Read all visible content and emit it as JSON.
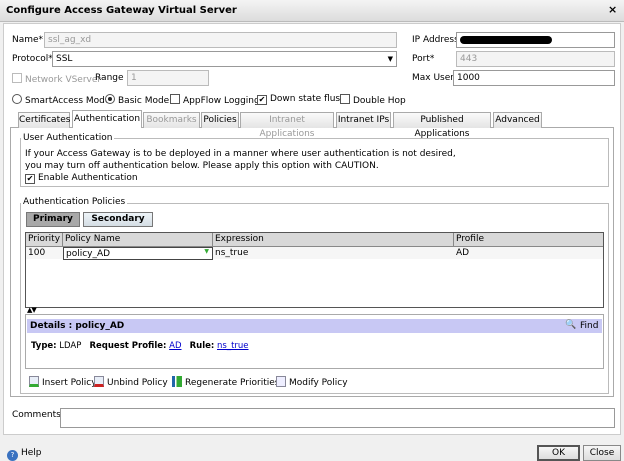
{
  "window": {
    "title": "Configure Access Gateway Virtual Server",
    "close": "×"
  },
  "form": {
    "name_label": "Name*",
    "name_value": "ssl_ag_xd",
    "ip_label": "IP Address",
    "protocol_label": "Protocol*",
    "protocol_value": "SSL",
    "port_label": "Port*",
    "port_value": "443",
    "network_vserver_label": "Network VServer",
    "range_label": "Range",
    "range_value": "1",
    "max_users_label": "Max Users",
    "max_users_value": "1000",
    "smartaccess_label": "SmartAccess Mode",
    "basic_label": "Basic Mode",
    "appflow_label": "AppFlow Logging",
    "downstate_label": "Down state flush",
    "doublehop_label": "Double Hop"
  },
  "tabs": [
    "Certificates",
    "Authentication",
    "Bookmarks",
    "Policies",
    "Intranet Applications",
    "Intranet IPs",
    "Published Applications",
    "Advanced"
  ],
  "user_auth": {
    "title": "User Authentication",
    "line1": "If your Access Gateway is to be deployed in a manner where user authentication is not desired,",
    "line2": "you may turn off authentication below. Please apply this option with CAUTION.",
    "enable_label": "Enable Authentication",
    "enable_check": "✔"
  },
  "auth_policies": {
    "title": "Authentication Policies",
    "primary": "Primary",
    "secondary": "Secondary",
    "columns": [
      "Priority",
      "Policy Name",
      "Expression",
      "Profile"
    ],
    "rows": [
      {
        "priority": "100",
        "policy": "policy_AD",
        "expression": "ns_true",
        "profile": "AD"
      }
    ]
  },
  "details": {
    "title": "Details : policy_AD",
    "find": "Find",
    "type_label": "Type:",
    "type_value": "LDAP",
    "req_label": "Request Profile:",
    "req_value": "AD",
    "rule_label": "Rule:",
    "rule_value": "ns_true"
  },
  "toolbar": {
    "insert": "Insert Policy",
    "unbind": "Unbind Policy",
    "regenerate": "Regenerate Priorities",
    "modify": "Modify Policy"
  },
  "comments_label": "Comments",
  "footer": {
    "help": "Help",
    "ok": "OK",
    "close": "Close"
  }
}
